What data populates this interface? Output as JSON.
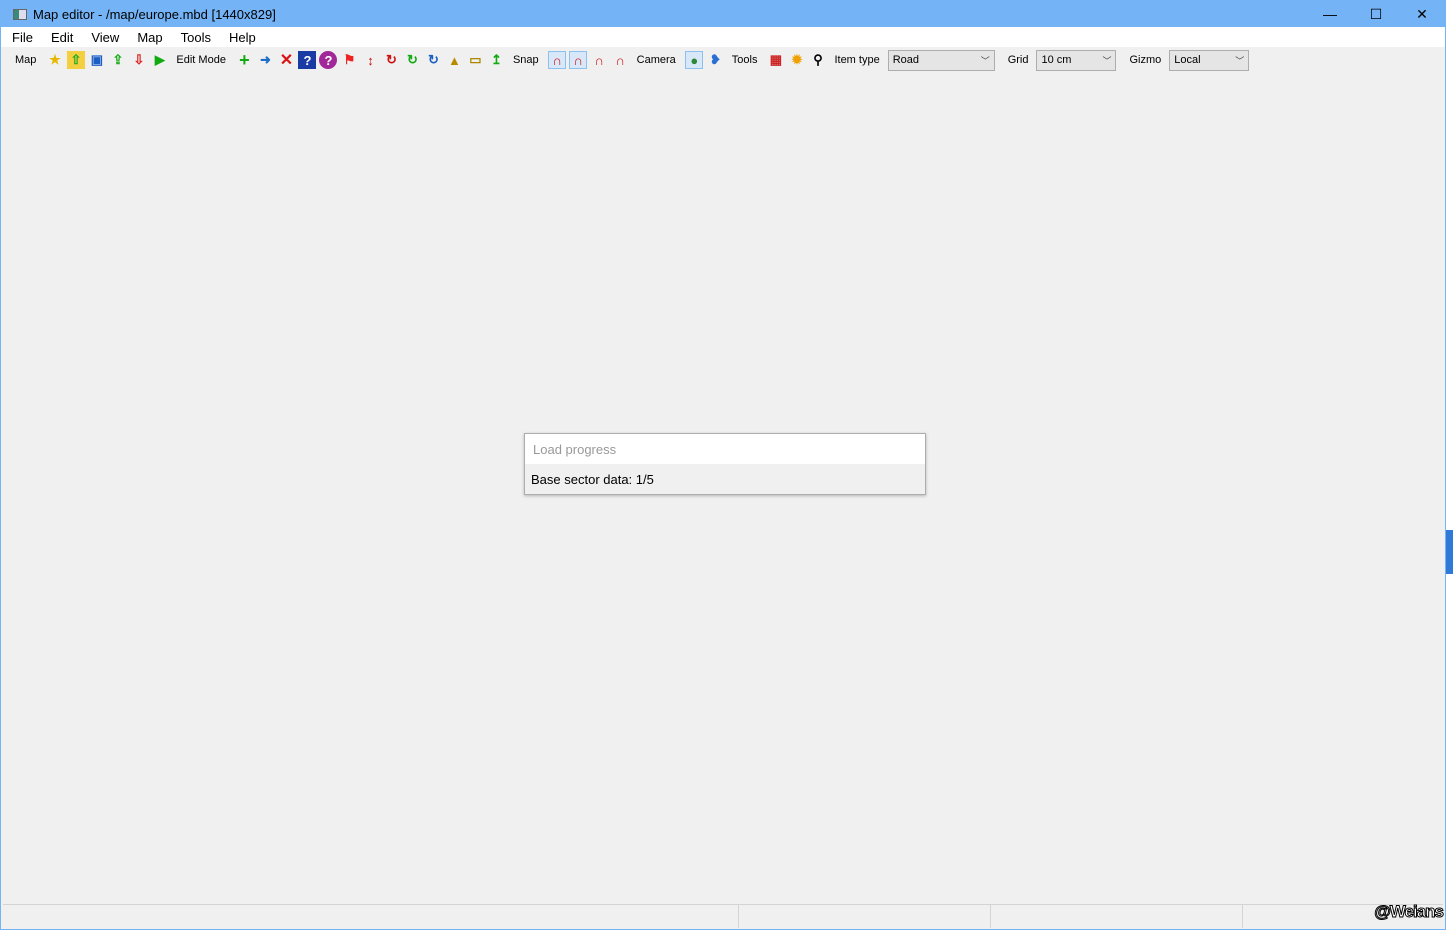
{
  "window": {
    "title": "Map editor - /map/europe.mbd [1440x829]",
    "minimize": "—",
    "maximize": "☐",
    "close": "✕"
  },
  "menu": [
    "File",
    "Edit",
    "View",
    "Map",
    "Tools",
    "Help"
  ],
  "toolbar": {
    "map_label": "Map",
    "edit_mode_label": "Edit Mode",
    "snap_label": "Snap",
    "camera_label": "Camera",
    "tools_label": "Tools",
    "item_type_label": "Item type",
    "item_type_value": "Road",
    "grid_label": "Grid",
    "grid_value": "10 cm",
    "gizmo_label": "Gizmo",
    "gizmo_value": "Local"
  },
  "dialog": {
    "title": "Load progress",
    "message": "Base sector data: 1/5"
  },
  "watermark": "@Weians"
}
